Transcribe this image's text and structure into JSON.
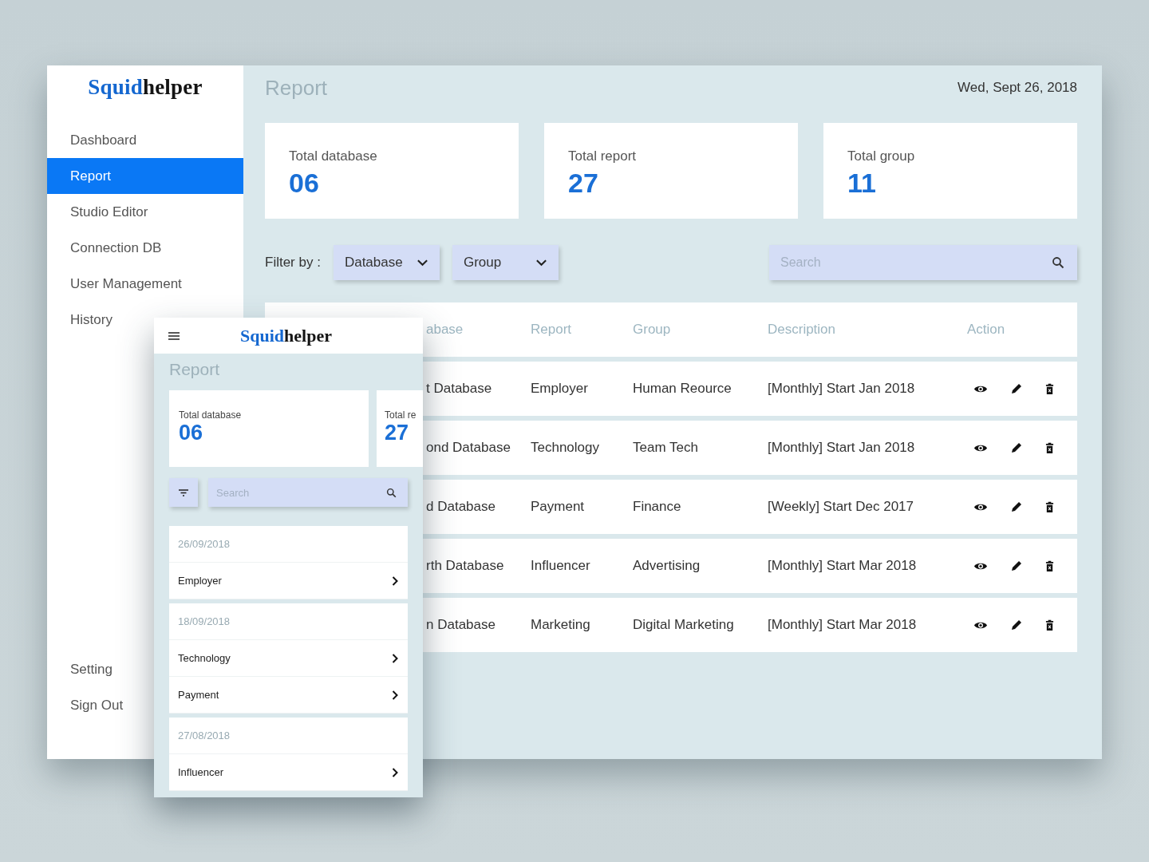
{
  "desktop": {
    "logo": [
      "Squid",
      "helper"
    ],
    "nav": [
      {
        "label": "Dashboard",
        "selected": false
      },
      {
        "label": "Report",
        "selected": true
      },
      {
        "label": "Studio Editor",
        "selected": false
      },
      {
        "label": "Connection DB",
        "selected": false
      },
      {
        "label": "User Management",
        "selected": false
      },
      {
        "label": "History",
        "selected": false
      }
    ],
    "nav_bottom": [
      "Setting",
      "Sign Out"
    ],
    "title": "Report",
    "date": "Wed, Sept 26, 2018",
    "stats": [
      {
        "label": "Total database",
        "value": "06"
      },
      {
        "label": "Total report",
        "value": "27"
      },
      {
        "label": "Total group",
        "value": "11"
      }
    ],
    "filter": {
      "label": "Filter by :",
      "dropdowns": [
        "Database",
        "Group"
      ]
    },
    "search": {
      "placeholder": "Search"
    },
    "table": {
      "columns": [
        "abase",
        "Report",
        "Group",
        "Description",
        "Action"
      ],
      "rows": [
        {
          "cells": [
            "t Database",
            "Employer",
            "Human Reource",
            "[Monthly] Start Jan 2018"
          ]
        },
        {
          "cells": [
            "ond Database",
            "Technology",
            "Team Tech",
            "[Monthly] Start Jan 2018"
          ]
        },
        {
          "cells": [
            "d Database",
            "Payment",
            "Finance",
            "[Weekly] Start Dec 2017"
          ]
        },
        {
          "cells": [
            "rth Database",
            "Influencer",
            "Advertising",
            "[Monthly] Start Mar 2018"
          ]
        },
        {
          "cells": [
            "n Database",
            "Marketing",
            "Digital Marketing",
            "[Monthly] Start Mar 2018"
          ]
        }
      ]
    }
  },
  "mobile": {
    "logo": [
      "Squid",
      "helper"
    ],
    "title": "Report",
    "stats": [
      {
        "label": "Total database",
        "value": "06"
      },
      {
        "label": "Total re",
        "value": "27"
      }
    ],
    "search": {
      "placeholder": "Search"
    },
    "groups": [
      {
        "date": "26/09/2018",
        "items": [
          "Employer"
        ]
      },
      {
        "date": "18/09/2018",
        "items": [
          "Technology",
          "Payment"
        ]
      },
      {
        "date": "27/08/2018",
        "items": [
          "Influencer"
        ]
      }
    ]
  }
}
